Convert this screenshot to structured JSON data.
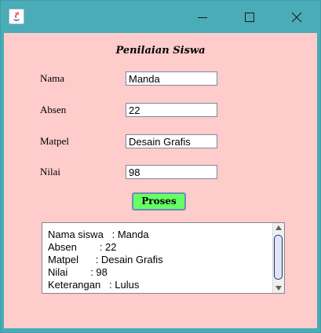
{
  "window": {
    "title_icon": "java-icon",
    "controls": [
      "minimize-icon",
      "maximize-icon",
      "close-icon"
    ]
  },
  "form": {
    "title": "Penilaian Siswa",
    "fields": [
      {
        "label": "Nama",
        "value": "Manda"
      },
      {
        "label": "Absen",
        "value": "22"
      },
      {
        "label": "Matpel",
        "value": "Desain Grafis"
      },
      {
        "label": "Nilai",
        "value": "98"
      }
    ],
    "button_label": "Proses"
  },
  "output": {
    "text": "Nama siswa   : Manda\nAbsen        : 22\nMatpel      : Desain Grafis\nNilai        : 98\nKeterangan   : Lulus"
  },
  "colors": {
    "titlebar": "#4aacb6",
    "content_bg": "#ffcccc",
    "button_bg": "#66ff66"
  }
}
